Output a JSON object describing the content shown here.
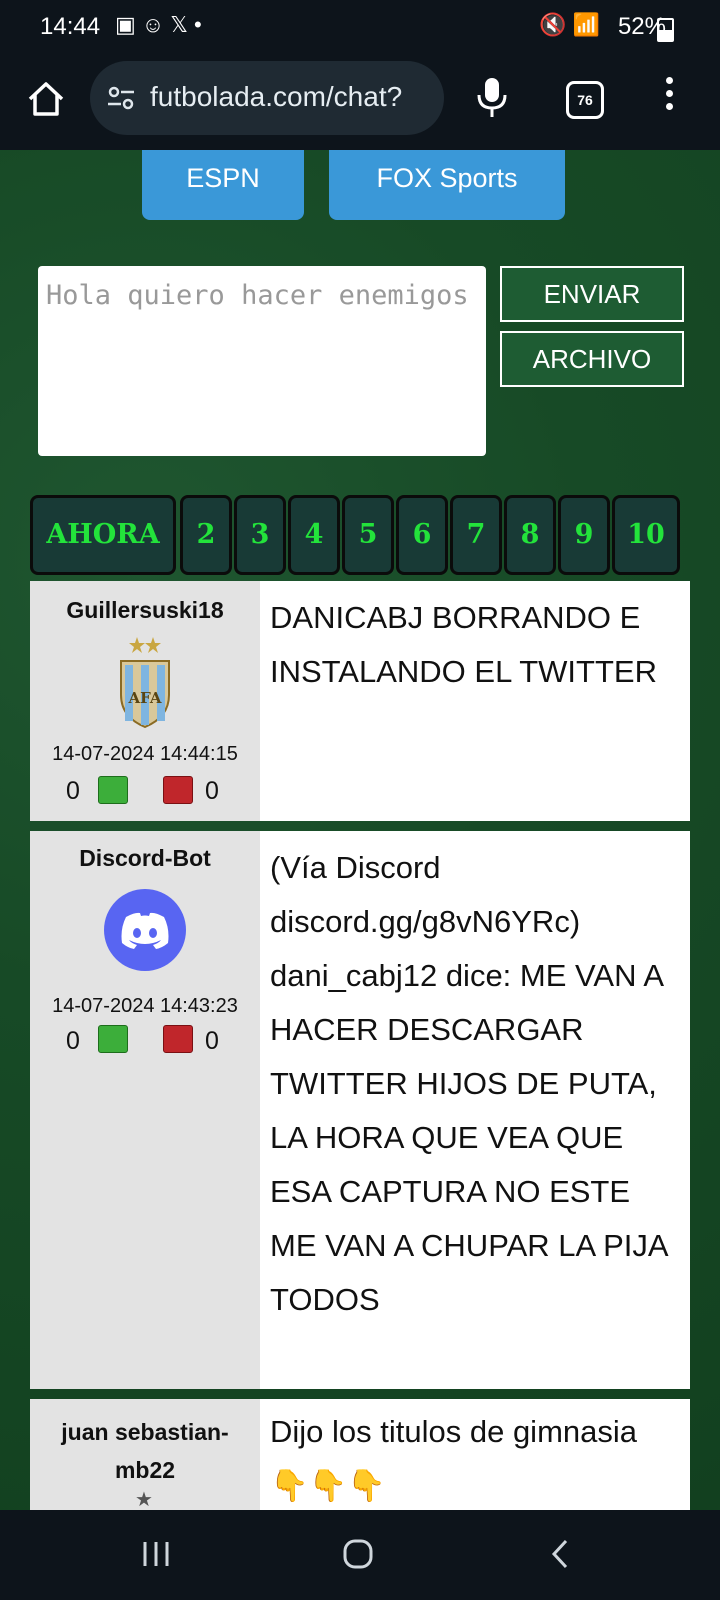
{
  "status_bar": {
    "time": "14:44",
    "notif_icons": [
      "image-icon",
      "discord-icon",
      "x-icon",
      "dot-icon"
    ],
    "battery": "52%"
  },
  "browser": {
    "url": "futbolada.com/chat?",
    "tab_count": "76"
  },
  "channels": [
    {
      "label": "ESPN"
    },
    {
      "label": "FOX Sports"
    }
  ],
  "composer": {
    "placeholder": "Hola quiero hacer enemigos",
    "send_label": "ENVIAR",
    "file_label": "ARCHIVO"
  },
  "pagination": {
    "pages": [
      "AHORA",
      "2",
      "3",
      "4",
      "5",
      "6",
      "7",
      "8",
      "9",
      "10"
    ]
  },
  "posts": [
    {
      "user": "Guillersuski18",
      "avatar": "afa-crest-icon",
      "date": "14-07-2024 14:44:15",
      "likes": "0",
      "dislikes": "0",
      "text": "DANICABJ BORRANDO E INSTALANDO EL TWITTER"
    },
    {
      "user": "Discord-Bot",
      "avatar": "discord-icon",
      "date": "14-07-2024 14:43:23",
      "likes": "0",
      "dislikes": "0",
      "text": "(Vía Discord discord.gg/g8vN6YRc) dani_cabj12 dice: ME VAN A HACER DESCARGAR TWITTER HIJOS DE PUTA, LA HORA QUE VEA QUE ESA CAPTURA NO ESTE ME VAN A CHUPAR LA PIJA TODOS"
    },
    {
      "user": "juan sebastian-mb22",
      "avatar": "star-icon",
      "text": "Dijo los titulos de gimnasia 👇👇👇"
    }
  ],
  "colors": {
    "page_bg": "#173d22",
    "tv_button": "#3a98d8",
    "action_button": "#1e5c33",
    "pager_text": "#23e33b",
    "like": "#3cae3a",
    "dislike": "#c0262b"
  }
}
